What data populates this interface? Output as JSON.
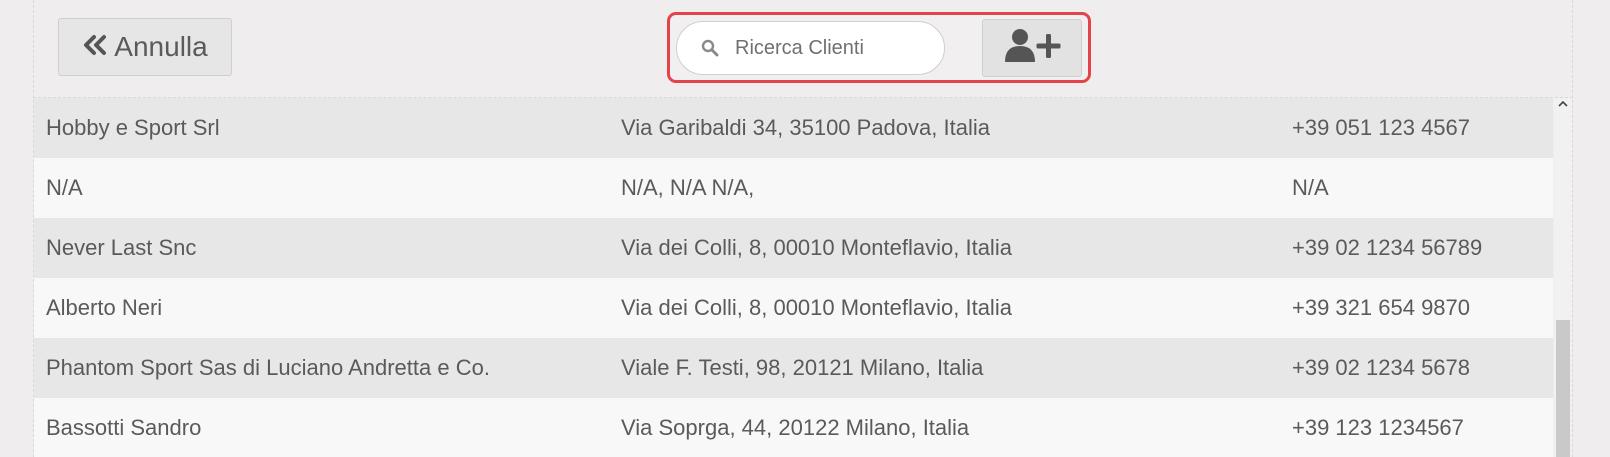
{
  "toolbar": {
    "cancel_label": "Annulla",
    "search_placeholder": "Ricerca Clienti",
    "search_value": ""
  },
  "icons": {
    "cancel": "double-chevron-left-icon",
    "search": "search-icon",
    "add_customer": "user-plus-icon",
    "scroll_up": "chevron-up-icon"
  },
  "colors": {
    "highlight_border": "#e5434b",
    "row_odd": "#e8e7e7",
    "row_even": "#f8f8f8"
  },
  "customers": [
    {
      "name": "Hobby e Sport Srl",
      "address": "Via Garibaldi 34, 35100 Padova, Italia",
      "phone": "+39 051 123 4567"
    },
    {
      "name": "N/A",
      "address": "N/A, N/A N/A,",
      "phone": "N/A"
    },
    {
      "name": "Never Last Snc",
      "address": "Via dei Colli, 8, 00010 Monteflavio, Italia",
      "phone": "+39 02 1234 56789"
    },
    {
      "name": "Alberto Neri",
      "address": "Via dei Colli, 8, 00010 Monteflavio, Italia",
      "phone": "+39 321 654 9870"
    },
    {
      "name": "Phantom Sport Sas di Luciano Andretta e Co.",
      "address": "Viale F. Testi, 98, 20121 Milano, Italia",
      "phone": "+39 02 1234 5678"
    },
    {
      "name": "Bassotti Sandro",
      "address": "Via Soprga, 44, 20122 Milano, Italia",
      "phone": "+39 123 1234567"
    }
  ]
}
